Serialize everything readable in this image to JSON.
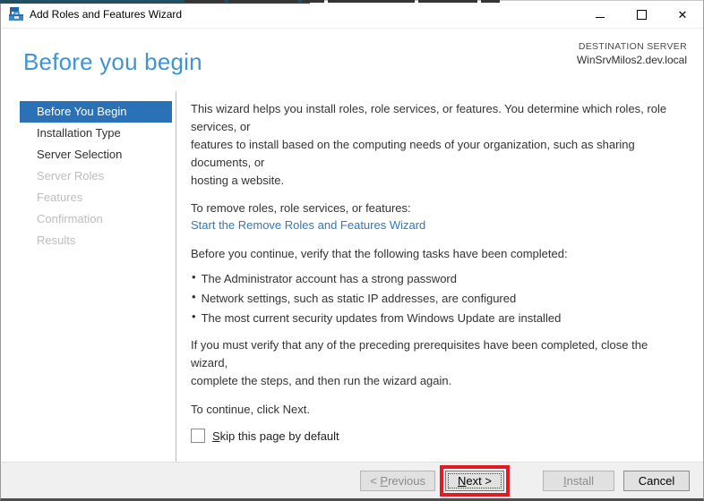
{
  "window": {
    "title": "Add Roles and Features Wizard",
    "icons": {
      "wizard-icon": "blue-toolbox-with-flag",
      "minimize-icon": "–",
      "maximize-icon": "□",
      "close-icon": "✕"
    }
  },
  "header": {
    "title": "Before you begin",
    "destination_label": "DESTINATION SERVER",
    "destination_server": "WinSrvMilos2.dev.local"
  },
  "sidebar": {
    "items": [
      {
        "label": "Before You Begin",
        "state": "selected"
      },
      {
        "label": "Installation Type",
        "state": "enabled"
      },
      {
        "label": "Server Selection",
        "state": "enabled"
      },
      {
        "label": "Server Roles",
        "state": "disabled"
      },
      {
        "label": "Features",
        "state": "disabled"
      },
      {
        "label": "Confirmation",
        "state": "disabled"
      },
      {
        "label": "Results",
        "state": "disabled"
      }
    ]
  },
  "main": {
    "intro": "This wizard helps you install roles, role services, or features. You determine which roles, role services, or\nfeatures to install based on the computing needs of your organization, such as sharing documents, or\nhosting a website.",
    "remove_heading": "To remove roles, role services, or features:",
    "remove_link": "Start the Remove Roles and Features Wizard",
    "verify_heading": "Before you continue, verify that the following tasks have been completed:",
    "bullet_glyph": "•",
    "bullets": [
      "The Administrator account has a strong password",
      "Network settings, such as static IP addresses, are configured",
      "The most current security updates from Windows Update are installed"
    ],
    "prereq_note": "If you must verify that any of the preceding prerequisites have been completed, close the wizard,\ncomplete the steps, and then run the wizard again.",
    "continue_note": "To continue, click Next."
  },
  "skip_checkbox": {
    "checked": false,
    "label_key": "S",
    "label_rest": "kip this page by default"
  },
  "buttons": {
    "previous": {
      "prefix": "< ",
      "key": "P",
      "rest": "revious",
      "state": "disabled"
    },
    "next": {
      "key": "N",
      "rest": "ext >",
      "state": "default-focused",
      "annotation": "red-highlight-box"
    },
    "install": {
      "key": "I",
      "rest": "nstall",
      "state": "disabled"
    },
    "cancel": {
      "label": "Cancel",
      "state": "enabled"
    }
  },
  "colors": {
    "sidebar_selected": "#2b71b8",
    "header_title": "#3e95d3",
    "link": "#3079bd",
    "annotation_red": "#e01b24",
    "top_border_teal": "#1e4f63",
    "buttonbar_bg": "#f0f0f0"
  }
}
